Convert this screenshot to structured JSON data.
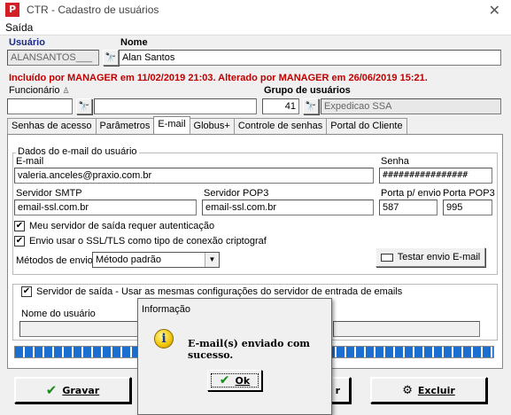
{
  "window": {
    "title": "CTR - Cadastro de usuários",
    "icon_letter": "P"
  },
  "menu": {
    "saida": "Saída"
  },
  "header": {
    "usuario_label": "Usuário",
    "usuario_value": "ALANSANTOS___",
    "nome_label": "Nome",
    "nome_value": "Alan Santos",
    "red_note": "Incluído por MANAGER em 11/02/2019 21:03. Alterado por MANAGER em 26/06/2019 15:21.",
    "funcionario_label": "Funcionário",
    "grupo_label": "Grupo de usuários",
    "grupo_code": "41",
    "grupo_name": "Expedicao SSA"
  },
  "tabs": [
    "Senhas de acesso",
    "Parâmetros",
    "E-mail",
    "Globus+",
    "Controle de senhas",
    "Portal do Cliente"
  ],
  "email_tab": {
    "group_title": "Dados do e-mail do usuário",
    "email_label": "E-mail",
    "email_value": "valeria.anceles@praxio.com.br",
    "senha_label": "Senha",
    "senha_value": "################",
    "smtp_label": "Servidor SMTP",
    "smtp_value": "email-ssl.com.br",
    "pop3_label": "Servidor POP3",
    "pop3_value": "email-ssl.com.br",
    "porta_envio_label": "Porta p/ envio",
    "porta_envio_value": "587",
    "porta_pop3_label": "Porta POP3",
    "porta_pop3_value": "995",
    "cb_auth": "Meu servidor de saída requer autenticação",
    "cb_ssl": "Envio usar o SSL/TLS como tipo de conexão criptograf",
    "metodos_label": "Métodos de envio",
    "metodos_value": "Método padrão",
    "testar_label": "Testar envio E-mail",
    "cb_saida": "Servidor de saída - Usar as mesmas configurações do servidor de entrada de emails",
    "nome_usuario_label": "Nome do usuário"
  },
  "progress": {
    "fraction": 1.0
  },
  "buttons": {
    "gravar": "Gravar",
    "r_partial": "r",
    "excluir": "Excluir"
  },
  "dialog": {
    "title": "Informação",
    "message": "E-mail(s) enviado com sucesso.",
    "ok": "Ok"
  }
}
